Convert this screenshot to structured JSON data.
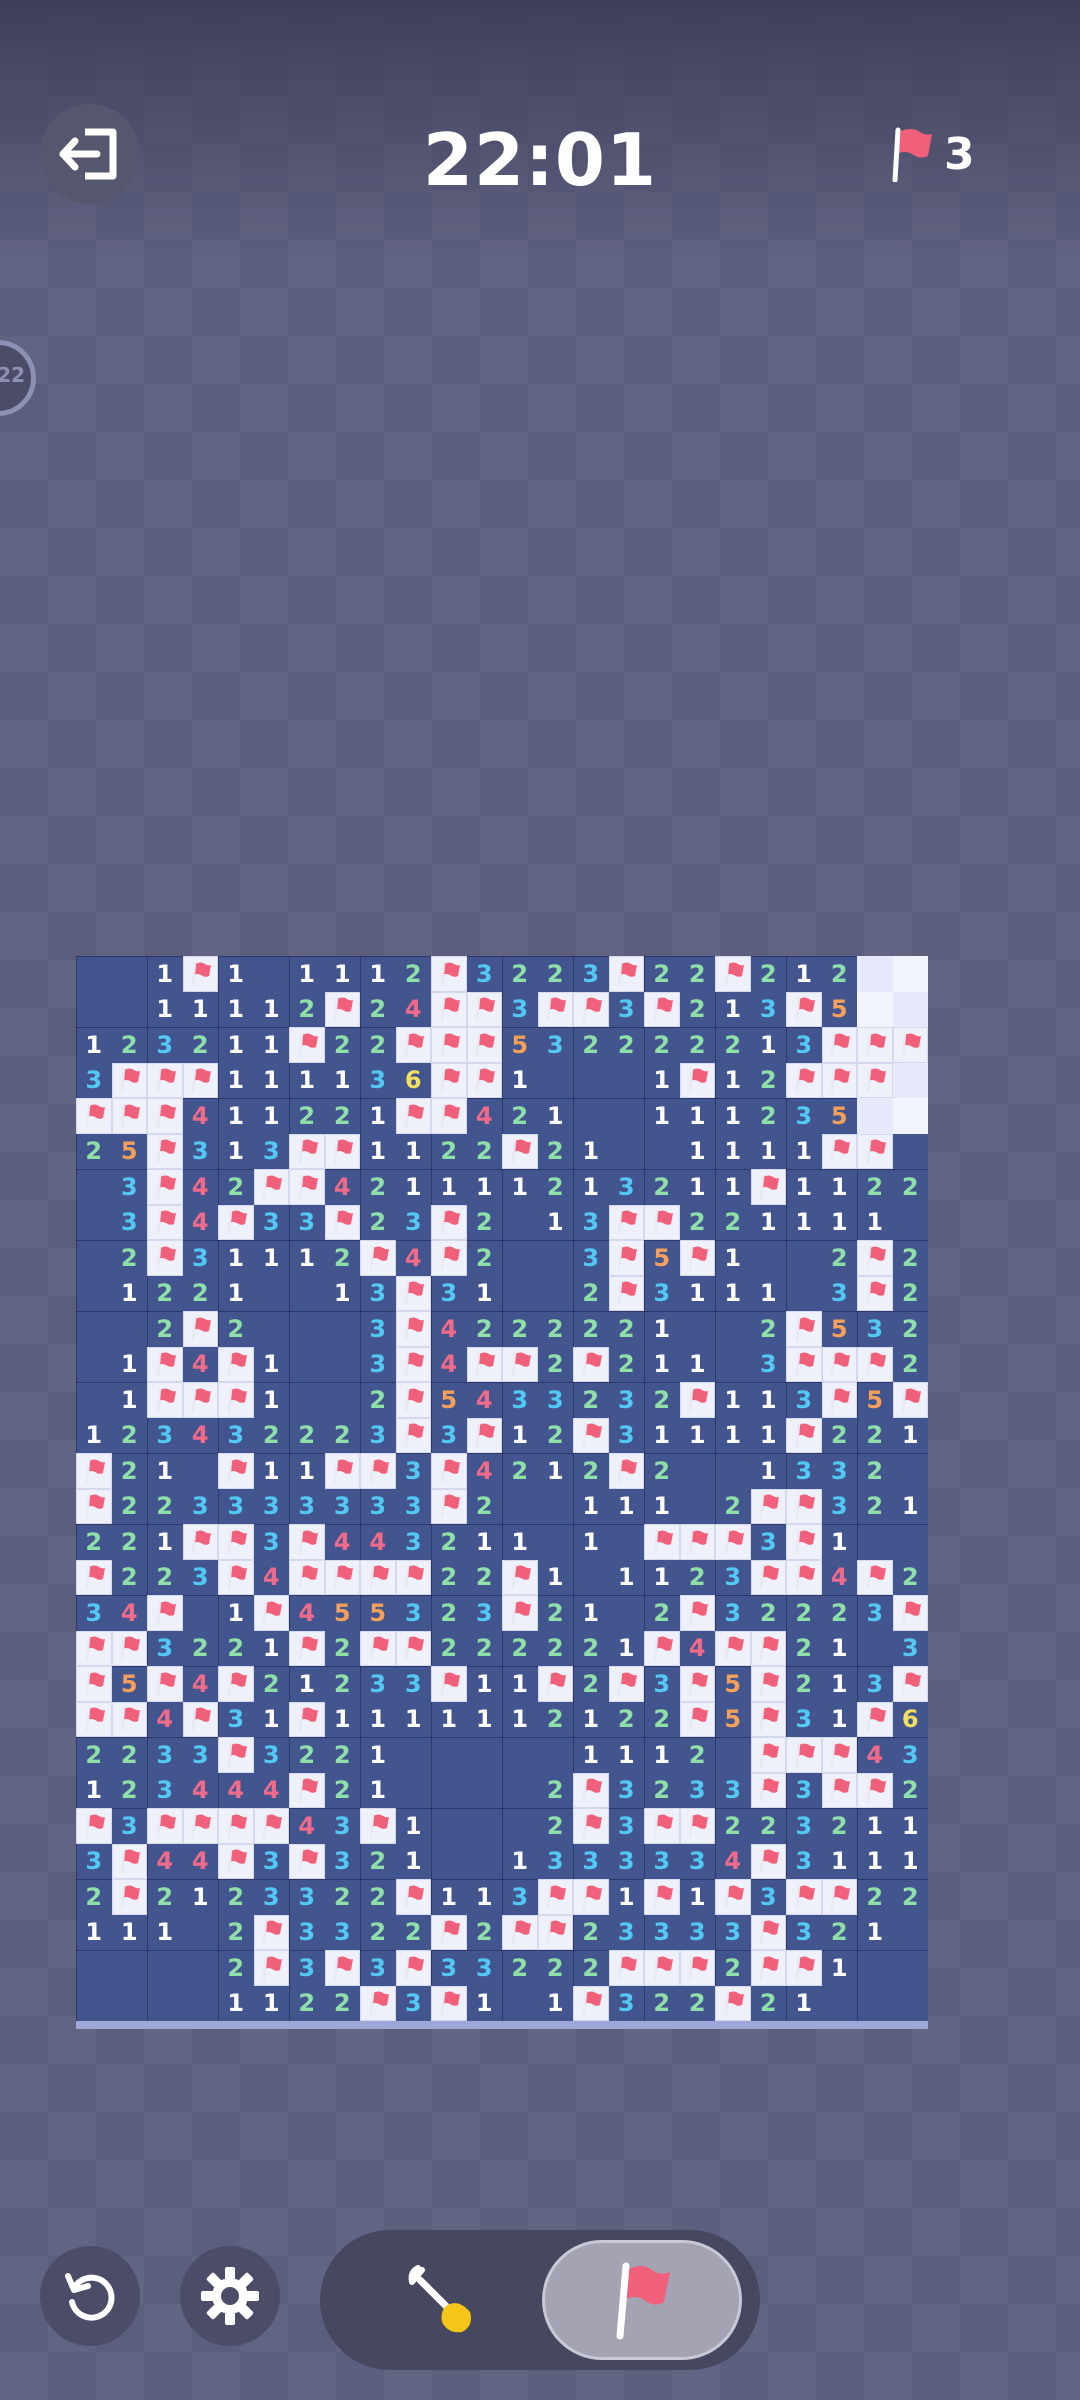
{
  "header": {
    "timer": "22:01",
    "flag_count": "3",
    "exit_icon": "exit-icon",
    "flag_icon": "flag-icon"
  },
  "colors": {
    "background": "#5c5e7e",
    "board": "#43558e",
    "flag": "#f0607a",
    "n1": "#ffffff",
    "n2": "#8fe0a8",
    "n3": "#52c8f2",
    "n4": "#f06a8a",
    "n5": "#f5a05a",
    "n6": "#f3e060"
  },
  "board": {
    "rows": [
      "..1F1.1112F3223F22F212HH",
      "..11112F24FF3FF3F213F5HH",
      "123211F22FFF532222213FFF",
      "3FFF111136FF1...1F12FFFH",
      "FFF411221FF421..111235HH",
      "25F313FF1122F21..1111FF.",
      ".3F42FF421111213211F1122",
      ".3F4F33F23F2.13FF221111.",
      ".2F31112F4F2..3F5F1..2F2",
      ".1221..13F31..2F3111.3F2",
      "..2F2...3F4222221..2F532",
      ".1F4F1..3F4FF2F211.3FFF2",
      ".1FFF1..2F5433232F113F5F",
      "123432223F3F12F31111F2211",
      "F21.F11FF3F4212F2..1332.",
      "F223333333F2..111.2FF321",
      "221FF3F443211.1.FFF3F1..",
      "F223F4FFFF22F1.1123FF4F2",
      "34F.1F455323F21.2F32223F",
      "FF3221F2FF222221F4FF21.3",
      "F5F4F21233F11F2F3F5F213F",
      "FF4F31F1111112122F5F31F6",
      "2233F3221.....1112.FFF43",
      "123444F21....2F3233F3FF2",
      "F3FFFF43F1...2F3FF223211",
      "3F44F3F321..1333334F3111",
      "2F2123322F113FF1F1F3FF22F",
      "111.2F3322F2FF23333F321.",
      "....2F3F3F33222FFF2FF1..",
      "....1122F3F1.1F322F21..."
    ]
  }
}
